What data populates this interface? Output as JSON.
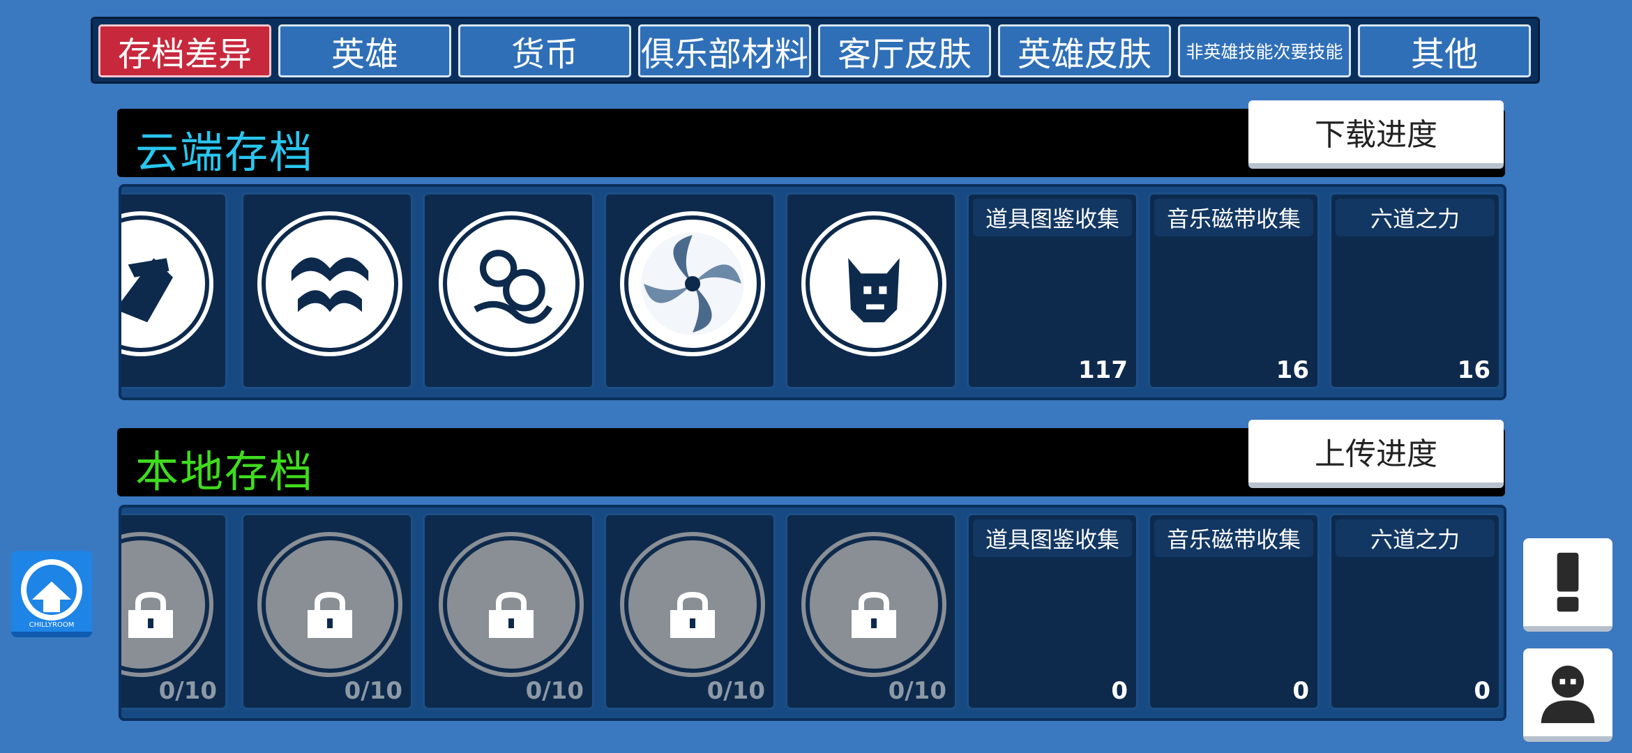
{
  "tabs": [
    {
      "label": "存档差异",
      "active": true
    },
    {
      "label": "英雄"
    },
    {
      "label": "货币"
    },
    {
      "label": "俱乐部材料"
    },
    {
      "label": "客厅皮肤"
    },
    {
      "label": "英雄皮肤"
    },
    {
      "label": "非英雄技能次要技能"
    },
    {
      "label": "其他"
    }
  ],
  "cloud": {
    "title": "云端存档",
    "title_color": "#29c6ef",
    "action": "下载进度",
    "stats": [
      {
        "label": "道具图鉴收集",
        "value": "117"
      },
      {
        "label": "音乐磁带收集",
        "value": "16"
      },
      {
        "label": "六道之力",
        "value": "16"
      }
    ]
  },
  "local": {
    "title": "本地存档",
    "title_color": "#3fdc1e",
    "action": "上传进度",
    "emblem_counts": [
      "0/10",
      "0/10",
      "0/10",
      "0/10",
      "0/10"
    ],
    "stats": [
      {
        "label": "道具图鉴收集",
        "value": "0"
      },
      {
        "label": "音乐磁带收集",
        "value": "0"
      },
      {
        "label": "六道之力",
        "value": "0"
      }
    ]
  },
  "emblem_icons": [
    "warrior-emblem-icon",
    "wave-emblem-icon",
    "cloud-emblem-icon",
    "vortex-emblem-icon",
    "demon-emblem-icon"
  ],
  "logo_text": "CHILLYROOM",
  "side_icons": [
    "exclamation-icon",
    "profile-icon"
  ],
  "colors": {
    "background": "#3a78bf",
    "active_tab": "#c8283c",
    "panel": "#174a83",
    "card": "#0d2a4d"
  }
}
